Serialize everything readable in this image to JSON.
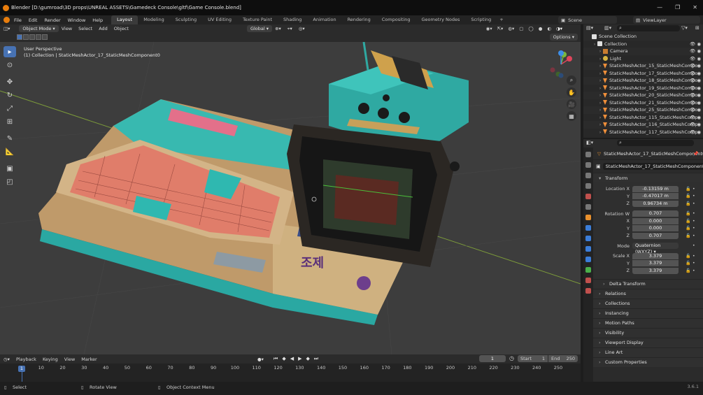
{
  "window": {
    "title": "Blender [D:\\gumroad\\3D props\\UNREAL ASSETS\\Gamedeck Console\\gltf\\Game Console.blend]"
  },
  "menu": [
    "File",
    "Edit",
    "Render",
    "Window",
    "Help"
  ],
  "workspaces": [
    "Layout",
    "Modeling",
    "Sculpting",
    "UV Editing",
    "Texture Paint",
    "Shading",
    "Animation",
    "Rendering",
    "Compositing",
    "Geometry Nodes",
    "Scripting",
    "+"
  ],
  "active_workspace": "Layout",
  "scene": {
    "name": "Scene",
    "view_layer": "ViewLayer"
  },
  "viewport_header": {
    "mode": "Object Mode",
    "items": [
      "View",
      "Select",
      "Add",
      "Object"
    ],
    "orientation": "Global",
    "options_label": "Options"
  },
  "viewport_info": {
    "line1": "User Perspective",
    "line2": "(1) Collection | StaticMeshActor_17_StaticMeshComponent0"
  },
  "timeline_header": {
    "items": [
      "Playback",
      "Keying",
      "View",
      "Marker"
    ],
    "current_frame": "1",
    "start_label": "Start",
    "start": "1",
    "end_label": "End",
    "end": "250"
  },
  "timeline_ticks": [
    "1",
    "10",
    "20",
    "30",
    "40",
    "50",
    "60",
    "70",
    "80",
    "90",
    "100",
    "110",
    "120",
    "130",
    "140",
    "150",
    "160",
    "170",
    "180",
    "190",
    "200",
    "210",
    "220",
    "230",
    "240",
    "250"
  ],
  "outliner": {
    "items": [
      {
        "label": "Scene Collection",
        "type": "scene",
        "indent": 0
      },
      {
        "label": "Collection",
        "type": "coll",
        "indent": 1
      },
      {
        "label": "Camera",
        "type": "cam",
        "indent": 2
      },
      {
        "label": "Light",
        "type": "light",
        "indent": 2
      },
      {
        "label": "StaticMeshActor_15_StaticMeshCompo",
        "type": "mesh",
        "indent": 2
      },
      {
        "label": "StaticMeshActor_17_StaticMeshCompo",
        "type": "mesh",
        "indent": 2
      },
      {
        "label": "StaticMeshActor_18_StaticMeshCompo",
        "type": "mesh",
        "indent": 2
      },
      {
        "label": "StaticMeshActor_19_StaticMeshCompo",
        "type": "mesh",
        "indent": 2
      },
      {
        "label": "StaticMeshActor_20_StaticMeshCompo",
        "type": "mesh",
        "indent": 2
      },
      {
        "label": "StaticMeshActor_21_StaticMeshCompo",
        "type": "mesh",
        "indent": 2
      },
      {
        "label": "StaticMeshActor_25_StaticMeshCompo",
        "type": "mesh",
        "indent": 2
      },
      {
        "label": "StaticMeshActor_115_StaticMeshComp",
        "type": "mesh",
        "indent": 2
      },
      {
        "label": "StaticMeshActor_116_StaticMeshComp",
        "type": "mesh",
        "indent": 2
      },
      {
        "label": "StaticMeshActor_117_StaticMeshComp",
        "type": "mesh",
        "indent": 2
      }
    ]
  },
  "properties": {
    "object_name": "StaticMeshActor_17_StaticMeshComponent0",
    "object_field": "StaticMeshActor_17_StaticMeshComponent0",
    "transform_label": "Transform",
    "location": {
      "label": "Location X",
      "x": "-0.13159 m",
      "y_label": "Y",
      "y": "-0.47017 m",
      "z_label": "Z",
      "z": "0.96734 m"
    },
    "rotation": {
      "label": "Rotation W",
      "w": "0.707",
      "x_label": "X",
      "x": "0.000",
      "y_label": "Y",
      "y": "0.000",
      "z_label": "Z",
      "z": "0.707"
    },
    "mode": {
      "label": "Mode",
      "value": "Quaternion (WXYZ)"
    },
    "scale": {
      "label": "Scale X",
      "x": "3.379",
      "y_label": "Y",
      "y": "3.379",
      "z_label": "Z",
      "z": "3.379"
    },
    "delta": "Delta Transform",
    "panels": [
      "Relations",
      "Collections",
      "Instancing",
      "Motion Paths",
      "Visibility",
      "Viewport Display",
      "Line Art",
      "Custom Properties"
    ]
  },
  "statusbar": {
    "select": "Select",
    "rotate": "Rotate View",
    "context": "Object Context Menu",
    "version": "3.6.1"
  },
  "colors": {
    "accent": "#4772b3",
    "orange": "#e87d0d",
    "teal": "#2fb8b0",
    "beige": "#d8b98a",
    "coral": "#e47c68"
  }
}
